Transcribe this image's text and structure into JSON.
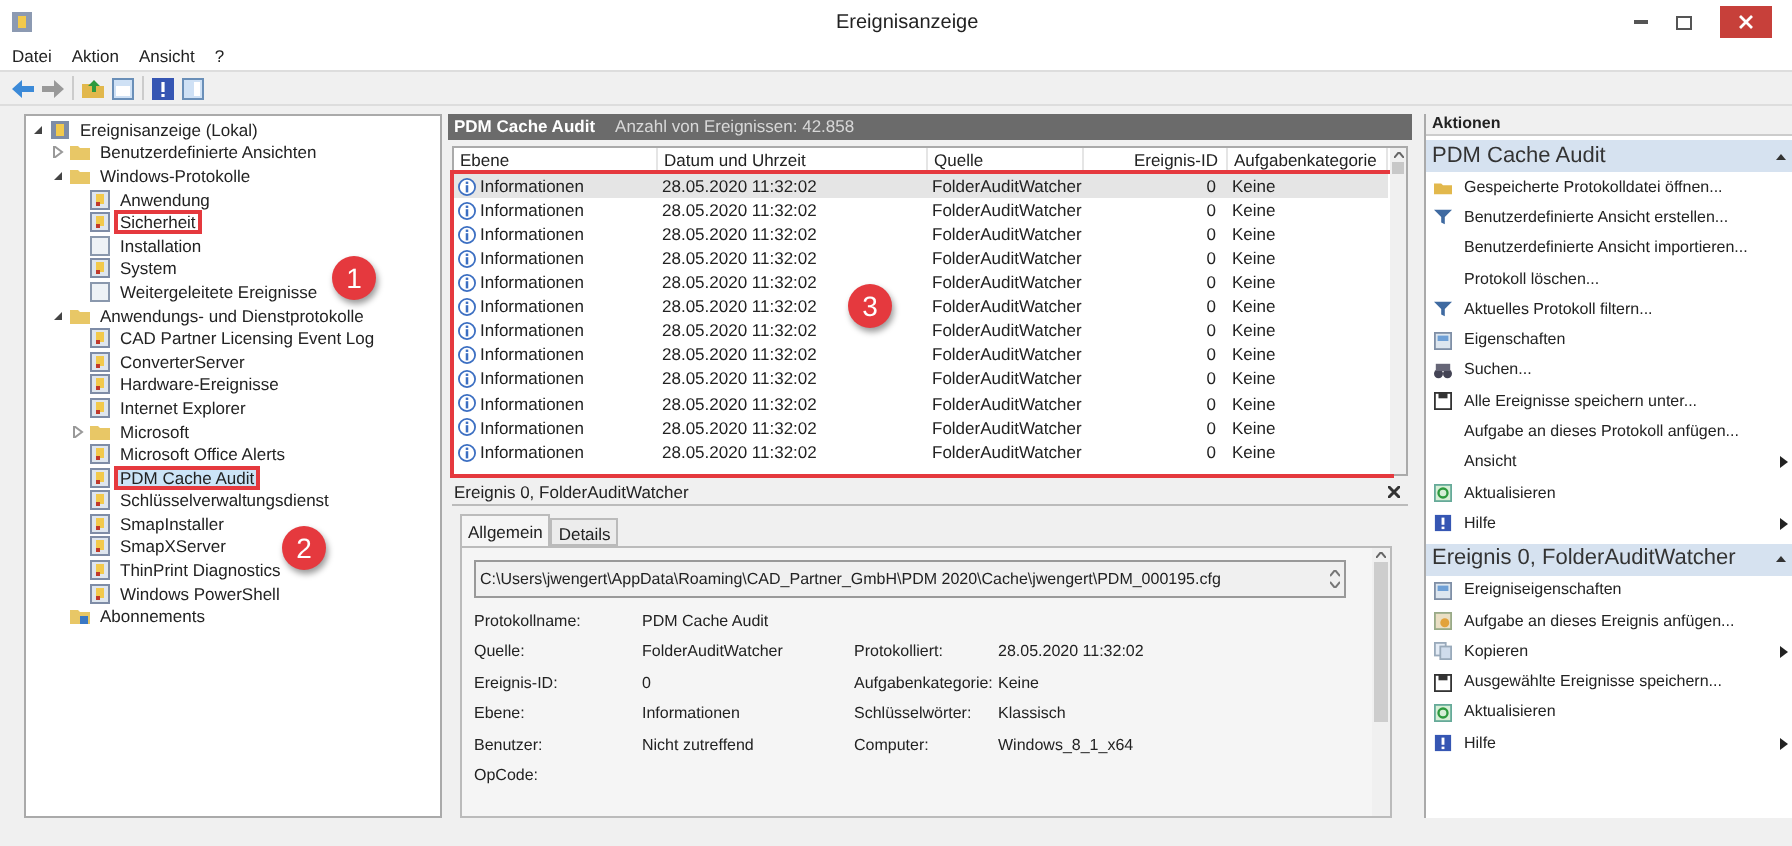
{
  "window": {
    "title": "Ereignisanzeige"
  },
  "menu": [
    "Datei",
    "Aktion",
    "Ansicht",
    "?"
  ],
  "tree": [
    {
      "label": "Ereignisanzeige (Lokal)",
      "kind": "viewer",
      "expanded": true,
      "selected": false,
      "highlighted": false,
      "children": [
        {
          "label": "Benutzerdefinierte Ansichten",
          "kind": "folder",
          "expanded": false,
          "selected": false,
          "highlighted": false
        },
        {
          "label": "Windows-Protokolle",
          "kind": "folder",
          "expanded": true,
          "selected": false,
          "highlighted": false,
          "children": [
            {
              "label": "Anwendung",
              "kind": "log",
              "selected": false,
              "highlighted": false
            },
            {
              "label": "Sicherheit",
              "kind": "log",
              "selected": false,
              "highlighted": true
            },
            {
              "label": "Installation",
              "kind": "plain",
              "selected": false,
              "highlighted": false
            },
            {
              "label": "System",
              "kind": "log",
              "selected": false,
              "highlighted": false
            },
            {
              "label": "Weitergeleitete Ereignisse",
              "kind": "plain",
              "selected": false,
              "highlighted": false
            }
          ]
        },
        {
          "label": "Anwendungs- und Dienstprotokolle",
          "kind": "folder",
          "expanded": true,
          "selected": false,
          "highlighted": false,
          "children": [
            {
              "label": "CAD Partner Licensing Event Log",
              "kind": "log",
              "selected": false,
              "highlighted": false
            },
            {
              "label": "ConverterServer",
              "kind": "log",
              "selected": false,
              "highlighted": false
            },
            {
              "label": "Hardware-Ereignisse",
              "kind": "log",
              "selected": false,
              "highlighted": false
            },
            {
              "label": "Internet Explorer",
              "kind": "log",
              "selected": false,
              "highlighted": false
            },
            {
              "label": "Microsoft",
              "kind": "folder",
              "expanded": false,
              "selected": false,
              "highlighted": false
            },
            {
              "label": "Microsoft Office Alerts",
              "kind": "log",
              "selected": false,
              "highlighted": false
            },
            {
              "label": "PDM Cache Audit",
              "kind": "log",
              "selected": true,
              "highlighted": true
            },
            {
              "label": "Schlüsselverwaltungsdienst",
              "kind": "log",
              "selected": false,
              "highlighted": false
            },
            {
              "label": "SmapInstaller",
              "kind": "log",
              "selected": false,
              "highlighted": false
            },
            {
              "label": "SmapXServer",
              "kind": "log",
              "selected": false,
              "highlighted": false
            },
            {
              "label": "ThinPrint Diagnostics",
              "kind": "log",
              "selected": false,
              "highlighted": false
            },
            {
              "label": "Windows PowerShell",
              "kind": "log",
              "selected": false,
              "highlighted": false
            }
          ]
        },
        {
          "label": "Abonnements",
          "kind": "subs",
          "selected": false,
          "highlighted": false
        }
      ]
    }
  ],
  "log_header": {
    "title": "PDM Cache Audit",
    "count": "Anzahl von Ereignissen: 42.858"
  },
  "table": {
    "columns": [
      "Ebene",
      "Datum und Uhrzeit",
      "Quelle",
      "Ereignis-ID",
      "Aufgabenkategorie"
    ],
    "highlighted": true,
    "rows": [
      {
        "cells": [
          "Informationen",
          "28.05.2020 11:32:02",
          "FolderAuditWatcher",
          "0",
          "Keine"
        ],
        "selected": true
      },
      {
        "cells": [
          "Informationen",
          "28.05.2020 11:32:02",
          "FolderAuditWatcher",
          "0",
          "Keine"
        ],
        "selected": false
      },
      {
        "cells": [
          "Informationen",
          "28.05.2020 11:32:02",
          "FolderAuditWatcher",
          "0",
          "Keine"
        ],
        "selected": false
      },
      {
        "cells": [
          "Informationen",
          "28.05.2020 11:32:02",
          "FolderAuditWatcher",
          "0",
          "Keine"
        ],
        "selected": false
      },
      {
        "cells": [
          "Informationen",
          "28.05.2020 11:32:02",
          "FolderAuditWatcher",
          "0",
          "Keine"
        ],
        "selected": false
      },
      {
        "cells": [
          "Informationen",
          "28.05.2020 11:32:02",
          "FolderAuditWatcher",
          "0",
          "Keine"
        ],
        "selected": false
      },
      {
        "cells": [
          "Informationen",
          "28.05.2020 11:32:02",
          "FolderAuditWatcher",
          "0",
          "Keine"
        ],
        "selected": false
      },
      {
        "cells": [
          "Informationen",
          "28.05.2020 11:32:02",
          "FolderAuditWatcher",
          "0",
          "Keine"
        ],
        "selected": false
      },
      {
        "cells": [
          "Informationen",
          "28.05.2020 11:32:02",
          "FolderAuditWatcher",
          "0",
          "Keine"
        ],
        "selected": false
      },
      {
        "cells": [
          "Informationen",
          "28.05.2020 11:32:02",
          "FolderAuditWatcher",
          "0",
          "Keine"
        ],
        "selected": false
      },
      {
        "cells": [
          "Informationen",
          "28.05.2020 11:32:02",
          "FolderAuditWatcher",
          "0",
          "Keine"
        ],
        "selected": false
      },
      {
        "cells": [
          "Informationen",
          "28.05.2020 11:32:02",
          "FolderAuditWatcher",
          "0",
          "Keine"
        ],
        "selected": false
      }
    ]
  },
  "annotations": [
    "1",
    "2",
    "3"
  ],
  "detail": {
    "title": "Ereignis 0, FolderAuditWatcher",
    "tabs": [
      {
        "label": "Allgemein",
        "selected": true
      },
      {
        "label": "Details",
        "selected": false
      }
    ],
    "message": "C:\\Users\\jwengert\\AppData\\Roaming\\CAD_Partner_GmbH\\PDM 2020\\Cache\\jwengert\\PDM_000195.cfg",
    "properties": [
      [
        {
          "label": "Protokollname:",
          "value": "PDM Cache Audit"
        }
      ],
      [
        {
          "label": "Quelle:",
          "value": "FolderAuditWatcher"
        },
        {
          "label": "Protokolliert:",
          "value": "28.05.2020 11:32:02"
        }
      ],
      [
        {
          "label": "Ereignis-ID:",
          "value": "0"
        },
        {
          "label": "Aufgabenkategorie:",
          "value": "Keine"
        }
      ],
      [
        {
          "label": "Ebene:",
          "value": "Informationen"
        },
        {
          "label": "Schlüsselwörter:",
          "value": "Klassisch"
        }
      ],
      [
        {
          "label": "Benutzer:",
          "value": "Nicht zutreffend"
        },
        {
          "label": "Computer:",
          "value": "Windows_8_1_x64"
        }
      ],
      [
        {
          "label": "OpCode:"
        }
      ]
    ]
  },
  "actions": {
    "title": "Aktionen",
    "sections": [
      {
        "title": "PDM Cache Audit",
        "items": [
          {
            "label": "Gespeicherte Protokolldatei öffnen...",
            "kind": "open",
            "submenu": false
          },
          {
            "label": "Benutzerdefinierte Ansicht erstellen...",
            "kind": "filter",
            "submenu": false
          },
          {
            "label": "Benutzerdefinierte Ansicht importieren...",
            "kind": "none",
            "submenu": false
          },
          {
            "label": "Protokoll löschen...",
            "kind": "none",
            "submenu": false
          },
          {
            "label": "Aktuelles Protokoll filtern...",
            "kind": "filter",
            "submenu": false
          },
          {
            "label": "Eigenschaften",
            "kind": "props",
            "submenu": false
          },
          {
            "label": "Suchen...",
            "kind": "find",
            "submenu": false
          },
          {
            "label": "Alle Ereignisse speichern unter...",
            "kind": "save",
            "submenu": false
          },
          {
            "label": "Aufgabe an dieses Protokoll anfügen...",
            "kind": "none",
            "submenu": false
          },
          {
            "label": "Ansicht",
            "kind": "none",
            "submenu": true
          },
          {
            "label": "Aktualisieren",
            "kind": "refresh",
            "submenu": false
          },
          {
            "label": "Hilfe",
            "kind": "help",
            "submenu": true
          }
        ]
      },
      {
        "title": "Ereignis 0, FolderAuditWatcher",
        "items": [
          {
            "label": "Ereigniseigenschaften",
            "kind": "props",
            "submenu": false
          },
          {
            "label": "Aufgabe an dieses Ereignis anfügen...",
            "kind": "task",
            "submenu": false
          },
          {
            "label": "Kopieren",
            "kind": "copy",
            "submenu": true
          },
          {
            "label": "Ausgewählte Ereignisse speichern...",
            "kind": "save",
            "submenu": false
          },
          {
            "label": "Aktualisieren",
            "kind": "refresh",
            "submenu": false
          },
          {
            "label": "Hilfe",
            "kind": "help",
            "submenu": true
          }
        ]
      }
    ]
  }
}
